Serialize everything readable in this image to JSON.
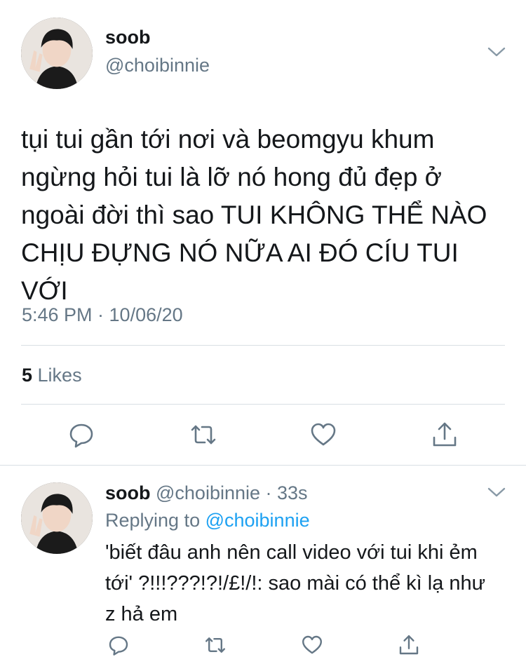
{
  "main_tweet": {
    "display_name": "soob",
    "handle": "@choibinnie",
    "text": "tụi tui gần tới nơi và beomgyu khum ngừng hỏi tui là lỡ nó hong đủ đẹp ở ngoài đời thì sao TUI KHÔNG THỂ NÀO CHỊU ĐỰNG NÓ NỮA AI ĐÓ CÍU TUI VỚI",
    "timestamp": "5:46 PM · 10/06/20",
    "likes_count": "5",
    "likes_label": " Likes"
  },
  "reply_tweet": {
    "display_name": "soob",
    "handle_and_time": " @choibinnie · 33s",
    "replying_prefix": "Replying to ",
    "replying_to": "@choibinnie",
    "text": "'biết đâu anh nên call video với tui khi ẻm tới' ?!!!???!?!/£!/!: sao mài có thể kì lạ như z hả em"
  },
  "icons": {
    "reply": "reply-icon",
    "retweet": "retweet-icon",
    "like": "heart-icon",
    "share": "share-icon",
    "menu": "chevron-down-icon"
  },
  "colors": {
    "text": "#14171a",
    "secondary": "#657786",
    "link": "#1da1f2",
    "divider": "#d8dee3"
  }
}
